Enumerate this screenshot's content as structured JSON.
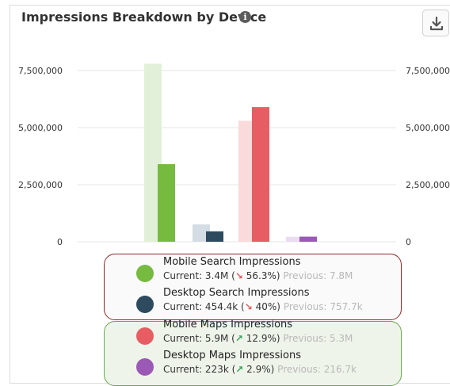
{
  "header": {
    "title": "Impressions Breakdown by Device",
    "info_icon": "i"
  },
  "toolbar": {
    "download_icon": "download-icon"
  },
  "chart_data": {
    "type": "bar",
    "title": "Impressions Breakdown by Device",
    "ylim": [
      0,
      7500000
    ],
    "yticks": [
      "7,500,000",
      "5,000,000",
      "2,500,000",
      "0"
    ],
    "right_yticks": [
      "7,500,000",
      "5,000,000",
      "2,500,000",
      "0"
    ],
    "grid": true,
    "series": [
      {
        "name": "Mobile Search Impressions",
        "current": 3400000,
        "previous": 7800000,
        "color": "#76bb40",
        "previous_color": "#e2f0d9"
      },
      {
        "name": "Desktop Search Impressions",
        "current": 454400,
        "previous": 757700,
        "color": "#2d4a5e",
        "previous_color": "#d5dde4"
      },
      {
        "name": "Mobile Maps Impressions",
        "current": 5900000,
        "previous": 5300000,
        "color": "#e85d64",
        "previous_color": "#fadadb"
      },
      {
        "name": "Desktop Maps Impressions",
        "current": 223000,
        "previous": 216700,
        "color": "#9b59b6",
        "previous_color": "#ebdcf1"
      }
    ]
  },
  "legend": [
    {
      "name": "Mobile Search Impressions",
      "current": "Current: 3.4M (",
      "arrow": "↘",
      "direction": "down",
      "change": "56.3%)",
      "previous": "Previous: 7.8M",
      "color": "#76bb40"
    },
    {
      "name": "Desktop Search Impressions",
      "current": "Current: 454.4k (",
      "arrow": "↘",
      "direction": "down",
      "change": "40%)",
      "previous": "Previous: 757.7k",
      "color": "#2d4a5e"
    },
    {
      "name": "Mobile Maps Impressions",
      "current": "Current: 5.9M (",
      "arrow": "↗",
      "direction": "up",
      "change": "12.9%)",
      "previous": "Previous: 5.3M",
      "color": "#e85d64"
    },
    {
      "name": "Desktop Maps Impressions",
      "current": "Current: 223k (",
      "arrow": "↗",
      "direction": "up",
      "change": "2.9%)",
      "previous": "Previous: 216.7k",
      "color": "#9b59b6"
    }
  ]
}
